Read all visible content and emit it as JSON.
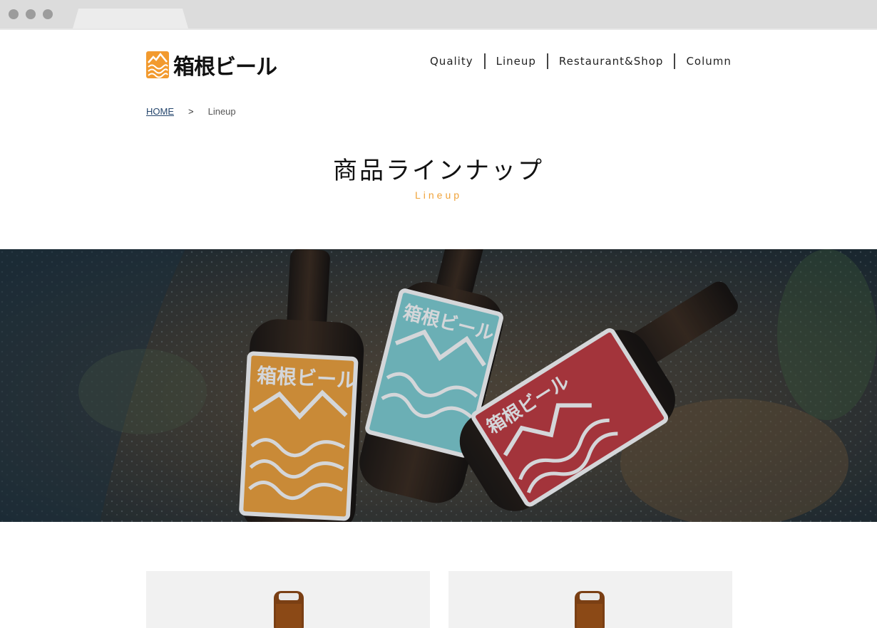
{
  "browser": {
    "dots": [
      "close",
      "minimize",
      "maximize"
    ]
  },
  "header": {
    "logo_text": "箱根ビール",
    "logo_mark": "fuji-wave-icon",
    "nav": [
      "Quality",
      "Lineup",
      "Restaurant&Shop",
      "Column"
    ]
  },
  "breadcrumb": {
    "home": "HOME",
    "separator": ">",
    "current": "Lineup"
  },
  "page_title": {
    "ja": "商品ラインナップ",
    "en": "Lineup"
  },
  "hero": {
    "image": "three-beer-bottles-on-wet-rocks",
    "bottle_labels": [
      "箱根ビール",
      "箱根ビール",
      "箱根ビール"
    ],
    "label_colors": [
      "#f2a33a",
      "#7fd0d3",
      "#c43a3f"
    ]
  },
  "products": {
    "cards": [
      {
        "image": "amber-bottle-top"
      },
      {
        "image": "amber-bottle-top"
      }
    ]
  },
  "colors": {
    "accent": "#f0a33a",
    "link": "#25466d"
  }
}
